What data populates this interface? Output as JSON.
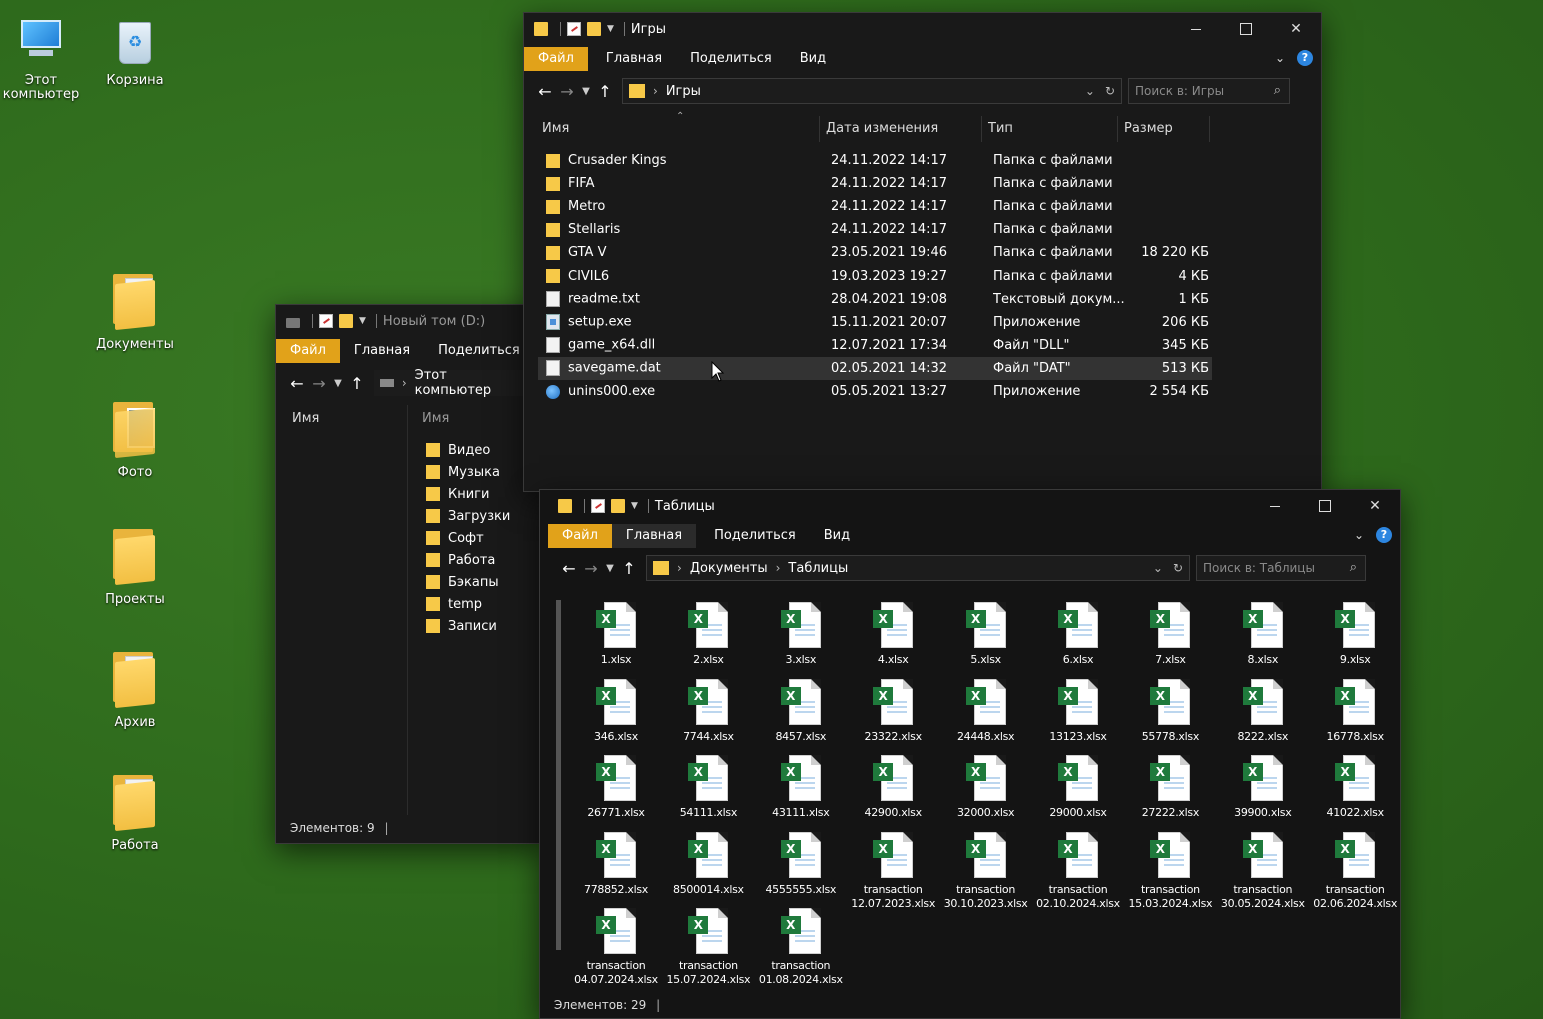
{
  "desktop": {
    "icons": [
      {
        "label_l1": "Этот",
        "label_l2": "компьютер",
        "icon": "computer-icon"
      },
      {
        "label": "Корзина",
        "icon": "recycle-bin-icon"
      },
      {
        "label": "Документы",
        "icon": "folder-icon"
      },
      {
        "label": "Фото",
        "icon": "folder-icon"
      },
      {
        "label": "Проекты",
        "icon": "folder-icon"
      },
      {
        "label": "Архив",
        "icon": "folder-icon"
      },
      {
        "label": "Работа",
        "icon": "folder-icon"
      }
    ]
  },
  "window_d": {
    "title": "Новый том (D:)",
    "ribbon": [
      "Файл",
      "Главная",
      "Поделиться"
    ],
    "ribbon_cut": "В",
    "address": "Этот компьютер",
    "nav_header": "Имя",
    "list_header": "Имя",
    "folders": [
      "Видео",
      "Музыка",
      "Книги",
      "Загрузки",
      "Софт",
      "Работа",
      "Бэкапы",
      "temp",
      "Записи"
    ],
    "status": "Элементов: 9"
  },
  "window_games": {
    "title": "Игры",
    "ribbon": [
      "Файл",
      "Главная",
      "Поделиться",
      "Вид"
    ],
    "address": [
      "Игры"
    ],
    "search_placeholder": "Поиск в: Игры",
    "columns": [
      "Имя",
      "Дата изменения",
      "Тип",
      "Размер"
    ],
    "rows": [
      {
        "name": "Crusader Kings",
        "date": "24.11.2022 14:17",
        "type": "Папка с файлами",
        "size": "",
        "kind": "folder"
      },
      {
        "name": "FIFA",
        "date": "24.11.2022 14:17",
        "type": "Папка с файлами",
        "size": "",
        "kind": "folder"
      },
      {
        "name": "Metro",
        "date": "24.11.2022 14:17",
        "type": "Папка с файлами",
        "size": "",
        "kind": "folder"
      },
      {
        "name": "Stellaris",
        "date": "24.11.2022 14:17",
        "type": "Папка с файлами",
        "size": "",
        "kind": "folder"
      },
      {
        "name": "GTA V",
        "date": "23.05.2021 19:46",
        "type": "Папка с файлами",
        "size": "18 220 КБ",
        "kind": "folder"
      },
      {
        "name": "CIVIL6",
        "date": "19.03.2023 19:27",
        "type": "Папка с файлами",
        "size": "4 КБ",
        "kind": "folder"
      },
      {
        "name": "readme.txt",
        "date": "28.04.2021 19:08",
        "type": "Текстовый докум...",
        "size": "1 КБ",
        "kind": "file"
      },
      {
        "name": "setup.exe",
        "date": "15.11.2021 20:07",
        "type": "Приложение",
        "size": "206 КБ",
        "kind": "exe"
      },
      {
        "name": "game_x64.dll",
        "date": "12.07.2021 17:34",
        "type": "Файл \"DLL\"",
        "size": "345 КБ",
        "kind": "file"
      },
      {
        "name": "savegame.dat",
        "date": "02.05.2021 14:32",
        "type": "Файл \"DAT\"",
        "size": "513 КБ",
        "kind": "file"
      },
      {
        "name": "unins000.exe",
        "date": "05.05.2021 13:27",
        "type": "Приложение",
        "size": "2 554 КБ",
        "kind": "globe"
      }
    ]
  },
  "window_tables": {
    "title": "Таблицы",
    "ribbon": [
      "Файл",
      "Главная",
      "Поделиться",
      "Вид"
    ],
    "address": [
      "Документы",
      "Таблицы"
    ],
    "search_placeholder": "Поиск в: Таблицы",
    "files": [
      [
        "1.xlsx"
      ],
      [
        "2.xlsx"
      ],
      [
        "3.xlsx"
      ],
      [
        "4.xlsx"
      ],
      [
        "5.xlsx"
      ],
      [
        "6.xlsx"
      ],
      [
        "7.xlsx"
      ],
      [
        "8.xlsx"
      ],
      [
        "9.xlsx"
      ],
      [
        "346.xlsx"
      ],
      [
        "7744.xlsx"
      ],
      [
        "8457.xlsx"
      ],
      [
        "23322.xlsx"
      ],
      [
        "24448.xlsx"
      ],
      [
        "13123.xlsx"
      ],
      [
        "55778.xlsx"
      ],
      [
        "8222.xlsx"
      ],
      [
        "16778.xlsx"
      ],
      [
        "26771.xlsx"
      ],
      [
        "54111.xlsx"
      ],
      [
        "43111.xlsx"
      ],
      [
        "42900.xlsx"
      ],
      [
        "32000.xlsx"
      ],
      [
        "29000.xlsx"
      ],
      [
        "27222.xlsx"
      ],
      [
        "39900.xlsx"
      ],
      [
        "41022.xlsx"
      ],
      [
        "778852.xlsx"
      ],
      [
        "8500014.xlsx"
      ],
      [
        "4555555.xlsx"
      ],
      [
        "transaction",
        "12.07.2023.xlsx"
      ],
      [
        "transaction",
        "30.10.2023.xlsx"
      ],
      [
        "transaction",
        "02.10.2024.xlsx"
      ],
      [
        "transaction",
        "15.03.2024.xlsx"
      ],
      [
        "transaction",
        "30.05.2024.xlsx"
      ],
      [
        "transaction",
        "02.06.2024.xlsx"
      ],
      [
        "transaction",
        "04.07.2024.xlsx"
      ],
      [
        "transaction",
        "15.07.2024.xlsx"
      ],
      [
        "transaction",
        "01.08.2024.xlsx"
      ]
    ],
    "status": "Элементов: 29"
  },
  "colors": {
    "accent": "#e1a21a",
    "desktop": "#2e6b1e",
    "window_bg": "#191919",
    "excel": "#1f7a3c"
  }
}
